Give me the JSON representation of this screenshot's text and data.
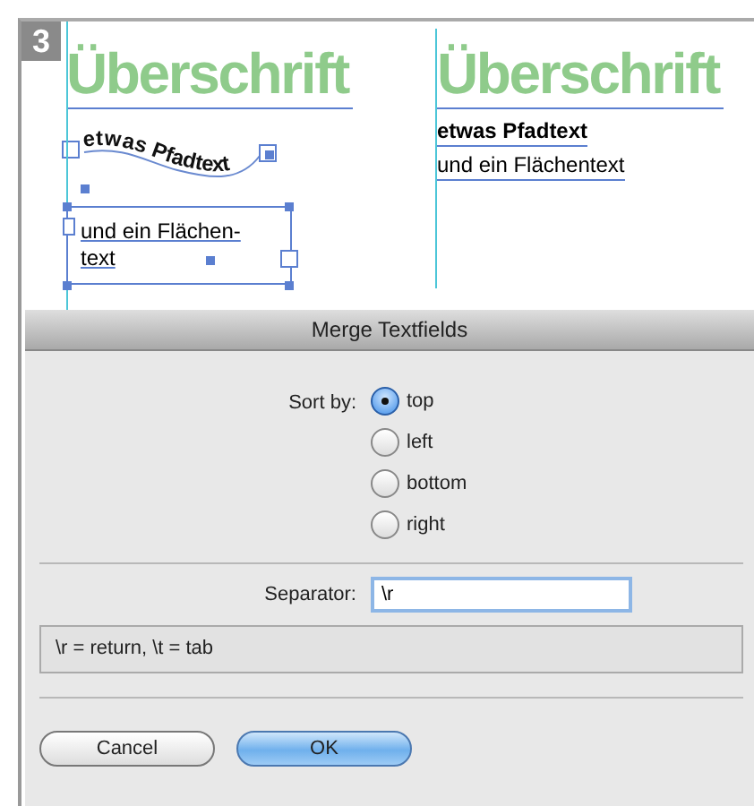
{
  "figure_number": "3",
  "canvas": {
    "left": {
      "heading": "Überschrift",
      "path_text": "etwas Pfadtext",
      "area_text_lines": [
        "und ein Flächen-",
        "text"
      ]
    },
    "right": {
      "heading": "Überschrift",
      "path_text": "etwas Pfadtext",
      "area_text": "und ein Flächentext"
    }
  },
  "dialog": {
    "title": "Merge Textfields",
    "sort_label": "Sort by:",
    "sort_options": [
      {
        "label": "top",
        "selected": true
      },
      {
        "label": "left",
        "selected": false
      },
      {
        "label": "bottom",
        "selected": false
      },
      {
        "label": "right",
        "selected": false
      }
    ],
    "separator_label": "Separator:",
    "separator_value": "\\r",
    "hint": "\\r = return, \\t = tab",
    "buttons": [
      {
        "label": "Cancel",
        "kind": "secondary"
      },
      {
        "label": "OK",
        "kind": "default"
      }
    ]
  }
}
